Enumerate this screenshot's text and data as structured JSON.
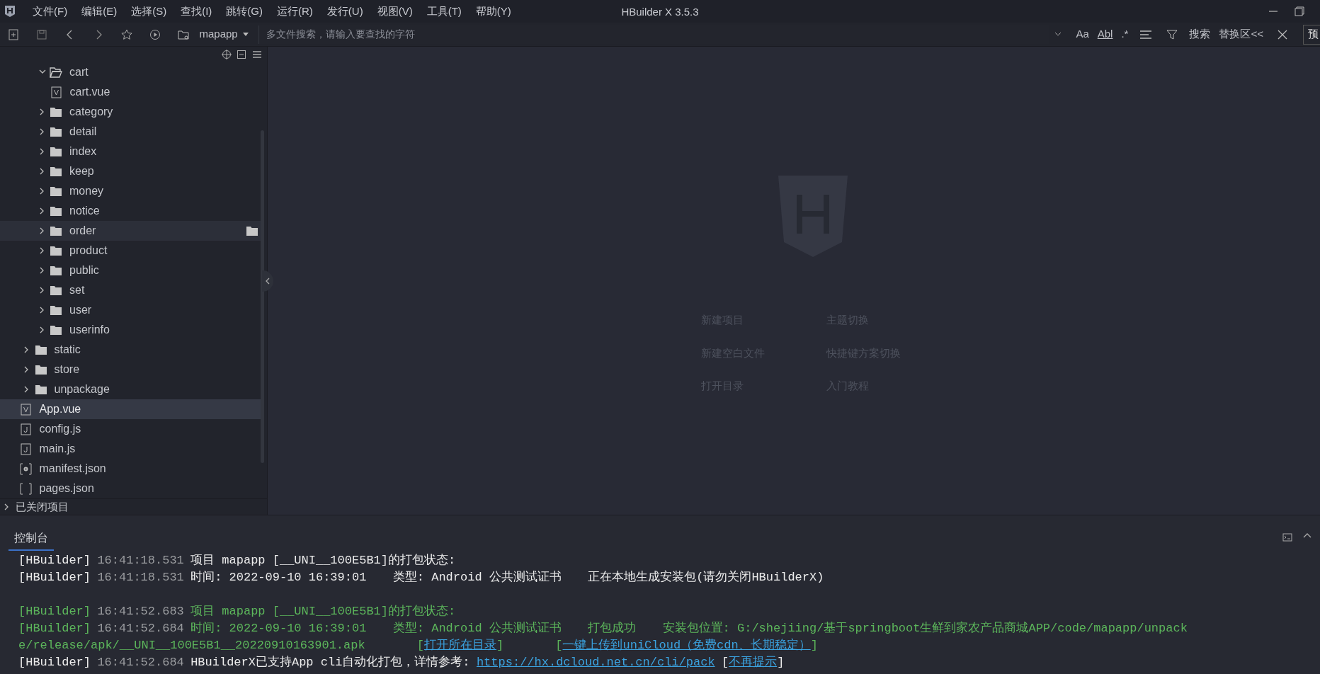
{
  "window": {
    "title": "HBuilder X 3.5.3"
  },
  "menu": [
    "文件(F)",
    "编辑(E)",
    "选择(S)",
    "查找(I)",
    "跳转(G)",
    "运行(R)",
    "发行(U)",
    "视图(V)",
    "工具(T)",
    "帮助(Y)"
  ],
  "toolbar": {
    "project": "mapapp",
    "search": {
      "placeholder": "多文件搜索，请输入要查找的字符"
    },
    "text_options": [
      "Aa",
      "Abl",
      ".*"
    ],
    "search_button": "搜索",
    "replace_button": "替换区<<",
    "preview_button": "预"
  },
  "tree": [
    {
      "children": [
        {
          "children": [
            {
              "label": "cart",
              "kind": "folder",
              "expanded": true,
              "selected": false,
              "hovered": false,
              "children": [
                {
                  "label": "cart.vue",
                  "kind": "vue",
                  "selected": false,
                  "hovered": false
                }
              ]
            },
            {
              "label": "category",
              "kind": "folder",
              "expanded": false,
              "selected": false,
              "hovered": false
            },
            {
              "label": "detail",
              "kind": "folder",
              "expanded": false,
              "selected": false,
              "hovered": false
            },
            {
              "label": "index",
              "kind": "folder",
              "expanded": false,
              "selected": false,
              "hovered": false
            },
            {
              "label": "keep",
              "kind": "folder",
              "expanded": false,
              "selected": false,
              "hovered": false
            },
            {
              "label": "money",
              "kind": "folder",
              "expanded": false,
              "selected": false,
              "hovered": false
            },
            {
              "label": "notice",
              "kind": "folder",
              "expanded": false,
              "selected": false,
              "hovered": false
            },
            {
              "label": "order",
              "kind": "folder",
              "expanded": false,
              "selected": false,
              "hovered": true
            },
            {
              "label": "product",
              "kind": "folder",
              "expanded": false,
              "selected": false,
              "hovered": false
            },
            {
              "label": "public",
              "kind": "folder",
              "expanded": false,
              "selected": false,
              "hovered": false
            },
            {
              "label": "set",
              "kind": "folder",
              "expanded": false,
              "selected": false,
              "hovered": false
            },
            {
              "label": "user",
              "kind": "folder",
              "expanded": false,
              "selected": false,
              "hovered": false
            },
            {
              "label": "userinfo",
              "kind": "folder",
              "expanded": false,
              "selected": false,
              "hovered": false
            }
          ]
        },
        {
          "label": "static",
          "kind": "folder",
          "expanded": false,
          "selected": false,
          "hovered": false
        },
        {
          "label": "store",
          "kind": "folder",
          "expanded": false,
          "selected": false,
          "hovered": false
        },
        {
          "label": "unpackage",
          "kind": "folder",
          "expanded": false,
          "selected": false,
          "hovered": false
        },
        {
          "label": "App.vue",
          "kind": "vue",
          "selected": true,
          "hovered": false
        },
        {
          "label": "config.js",
          "kind": "js",
          "selected": false,
          "hovered": false
        },
        {
          "label": "main.js",
          "kind": "js",
          "selected": false,
          "hovered": false
        },
        {
          "label": "manifest.json",
          "kind": "manifest",
          "selected": false,
          "hovered": false
        },
        {
          "label": "pages.json",
          "kind": "json",
          "selected": false,
          "hovered": false
        }
      ]
    }
  ],
  "closed_projects": "已关闭项目",
  "welcome_links": [
    "新建项目",
    "主题切换",
    "新建空白文件",
    "快捷键方案切换",
    "打开目录",
    "入门教程"
  ],
  "console": {
    "tab": "控制台",
    "blocks": [
      {
        "lines": [
          {
            "color": "#ececec",
            "parts": [
              {
                "kind": "tag",
                "text": "[HBuilder]"
              },
              {
                "kind": "time",
                "text": "16:41:18.531"
              },
              {
                "kind": "text",
                "text": "项目 mapapp [__UNI__100E5B1]的打包状态:"
              }
            ]
          },
          {
            "color": "#ececec",
            "parts": [
              {
                "kind": "tag",
                "text": "[HBuilder]"
              },
              {
                "kind": "time",
                "text": "16:41:18.531"
              },
              {
                "kind": "text",
                "text": "时间: 2022-09-10 16:39:01"
              },
              {
                "kind": "field",
                "text": "类型: Android 公共测试证书"
              },
              {
                "kind": "field",
                "text": "正在本地生成安装包(请勿关闭HBuilderX)"
              }
            ]
          }
        ]
      },
      {
        "lines": [
          {
            "color": "#5cb65b",
            "parts": [
              {
                "kind": "tag",
                "text": "[HBuilder]"
              },
              {
                "kind": "time",
                "text": "16:41:52.683"
              },
              {
                "kind": "text",
                "text": "项目 mapapp [__UNI__100E5B1]的打包状态:"
              }
            ]
          },
          {
            "color": "#5cb65b",
            "parts": [
              {
                "kind": "tag",
                "text": "[HBuilder]"
              },
              {
                "kind": "time",
                "text": "16:41:52.684"
              },
              {
                "kind": "text",
                "text": "时间: 2022-09-10 16:39:01"
              },
              {
                "kind": "field",
                "text": "类型: Android 公共测试证书"
              },
              {
                "kind": "field",
                "text": "打包成功"
              },
              {
                "kind": "field",
                "text": "安装包位置: G:/shejiing/基于springboot生鲜到家农产品商城APP/code/mapapp/unpack"
              }
            ]
          },
          {
            "color": "#5cb65b",
            "parts": [
              {
                "kind": "text",
                "text": "e/release/apk/__UNI__100E5B1__20220910163901.apk"
              },
              {
                "kind": "open_far",
                "text": "["
              },
              {
                "kind": "link",
                "text": "打开所在目录"
              },
              {
                "kind": "close",
                "text": "]"
              },
              {
                "kind": "open_far",
                "text": "["
              },
              {
                "kind": "link",
                "text": "一键上传到uniCloud（免费cdn、长期稳定）"
              },
              {
                "kind": "close",
                "text": "]"
              }
            ]
          },
          {
            "color": "#ececec",
            "parts": [
              {
                "kind": "tag",
                "text": "[HBuilder]"
              },
              {
                "kind": "time",
                "text": "16:41:52.684"
              },
              {
                "kind": "text",
                "text": "HBuilderX已支持App cli自动化打包，详情参考:"
              },
              {
                "kind": "link_near",
                "text": "https://hx.dcloud.net.cn/cli/pack"
              },
              {
                "kind": "open",
                "text": "["
              },
              {
                "kind": "link",
                "text": "不再提示"
              },
              {
                "kind": "close",
                "text": "]"
              }
            ]
          }
        ]
      }
    ]
  }
}
